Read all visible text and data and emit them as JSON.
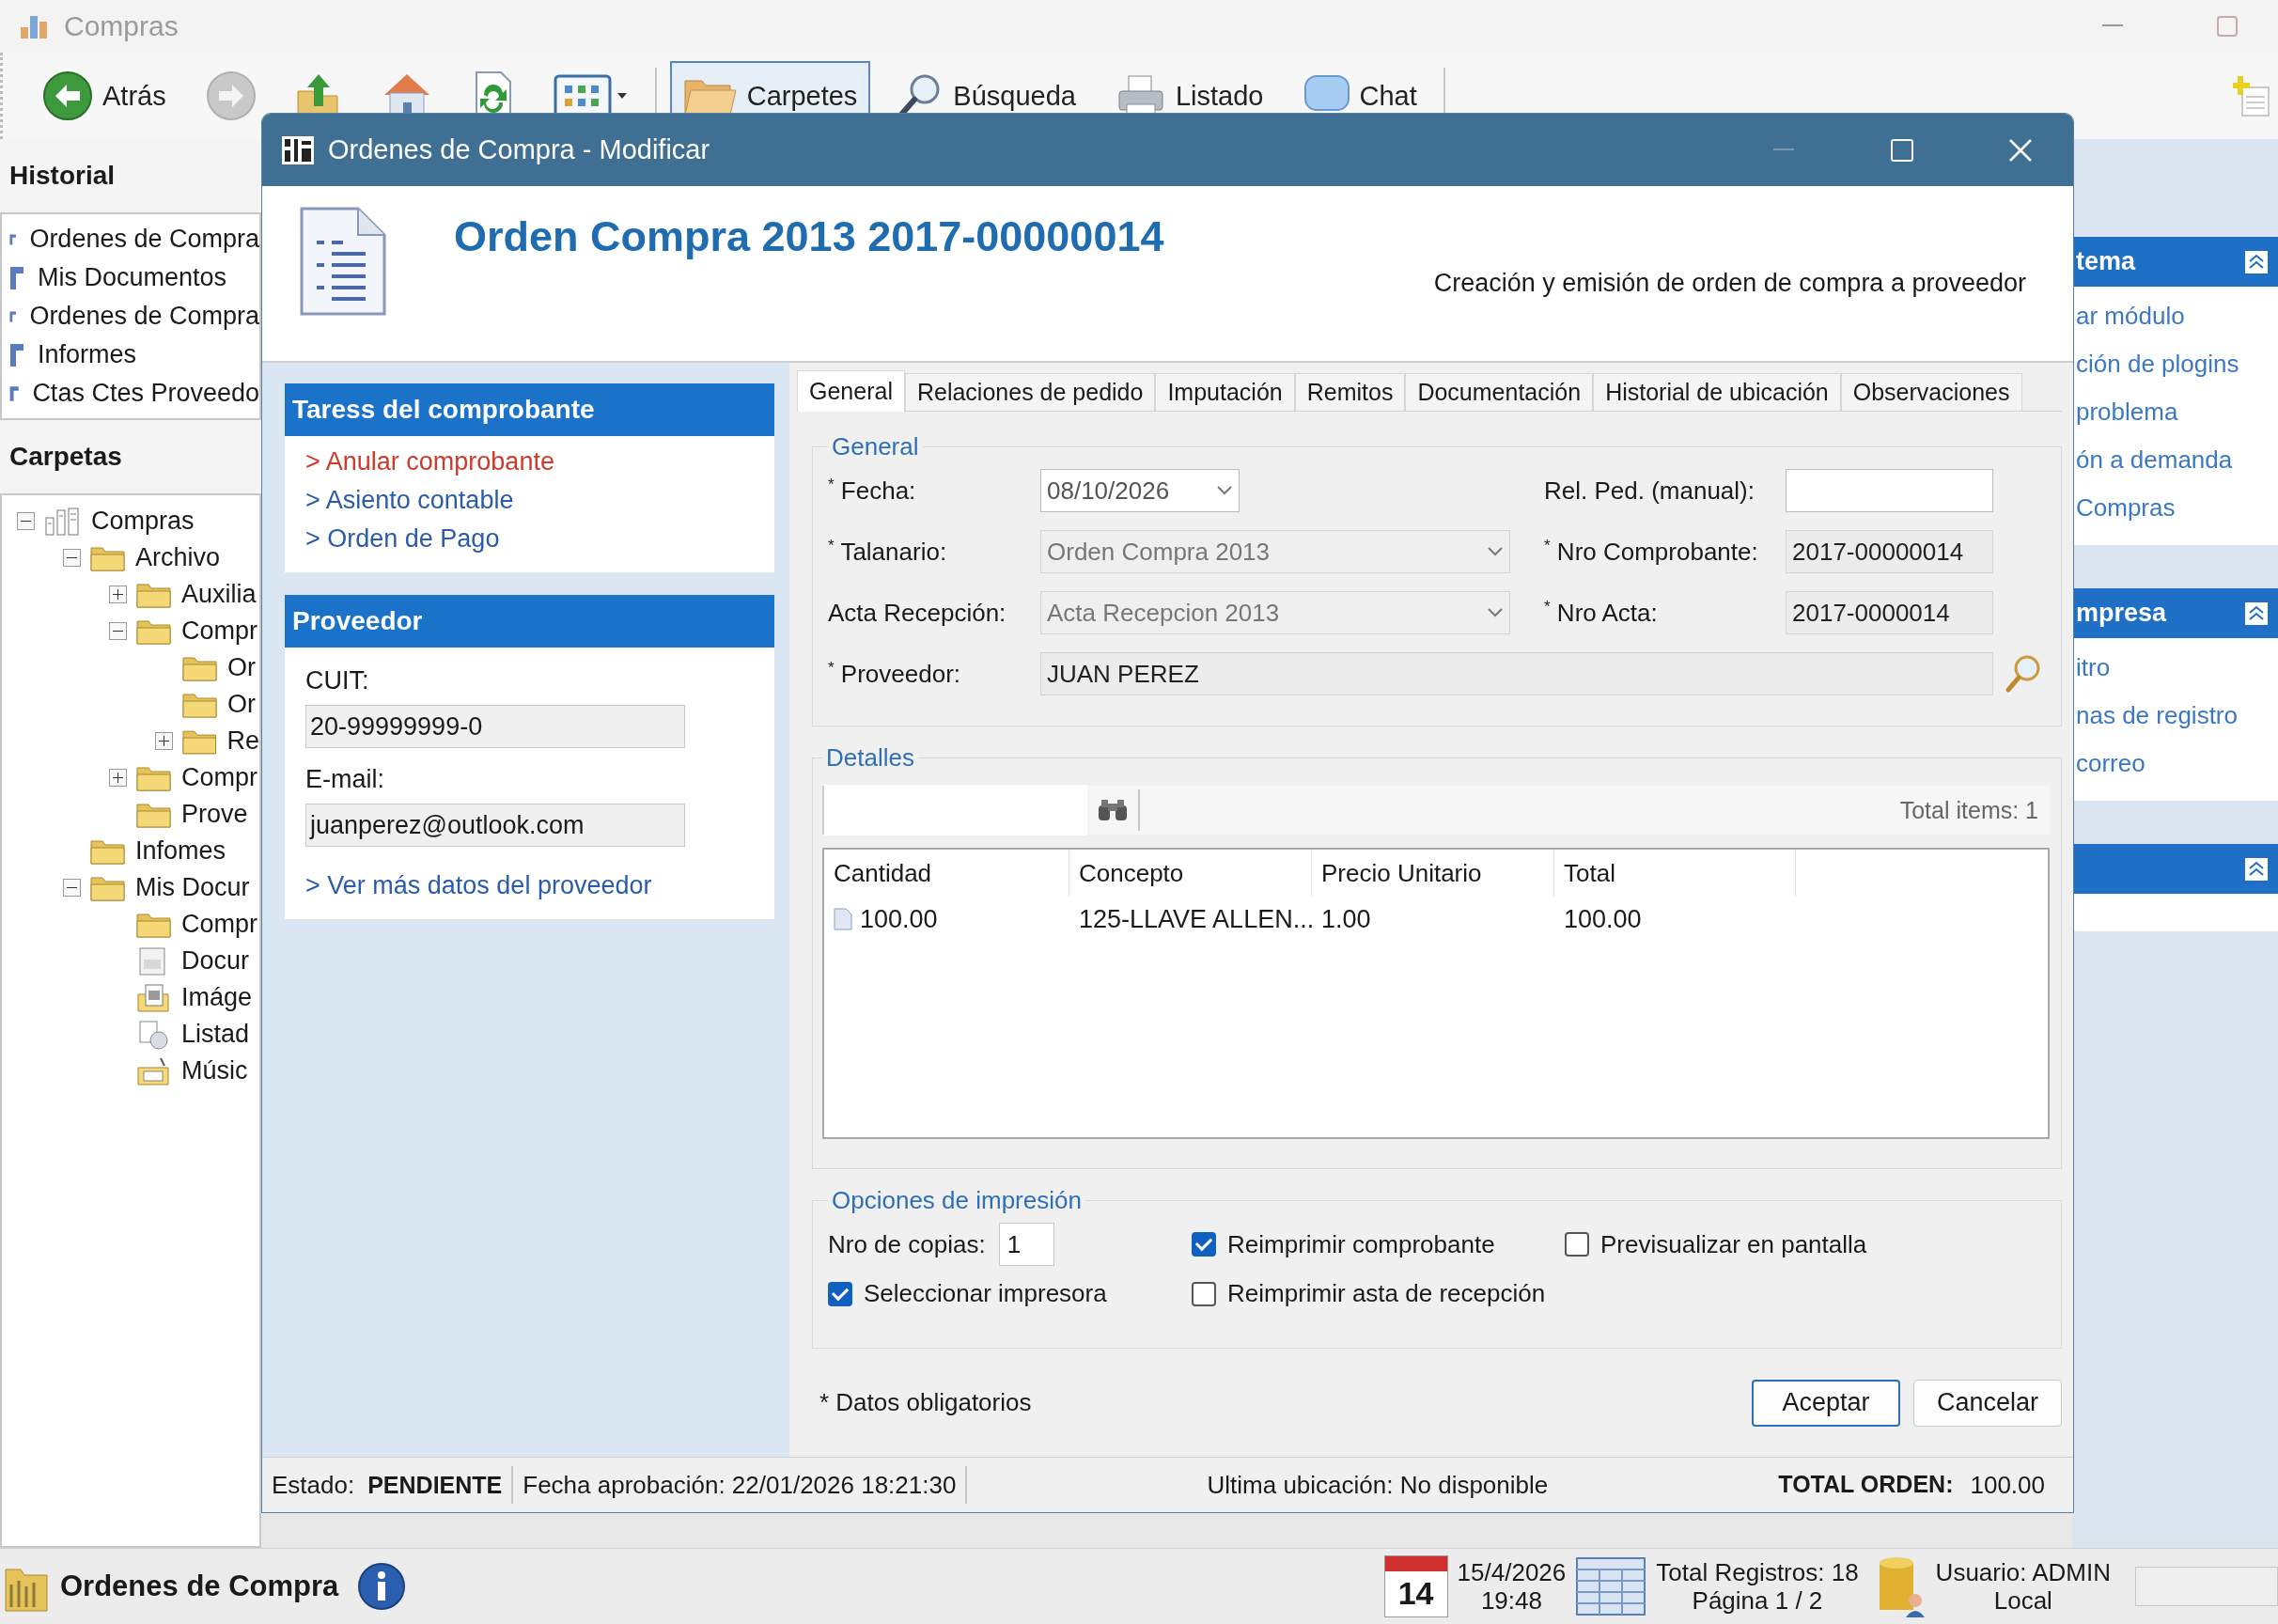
{
  "app": {
    "title": "Compras"
  },
  "toolbar": {
    "items": [
      {
        "kind": "back",
        "label": "Atrás",
        "selected": false
      },
      {
        "kind": "forward",
        "selected": false
      },
      {
        "kind": "up",
        "selected": false
      },
      {
        "kind": "home",
        "selected": false
      },
      {
        "kind": "refresh",
        "selected": false
      },
      {
        "kind": "views",
        "selected": false
      },
      {
        "kind": "folders",
        "label": "Carpetes",
        "selected": true
      },
      {
        "kind": "search",
        "label": "Búsqueda",
        "selected": false
      },
      {
        "kind": "print",
        "label": "Listado",
        "selected": false
      },
      {
        "kind": "chat",
        "label": "Chat",
        "selected": false
      }
    ]
  },
  "history": {
    "title": "Historial",
    "items": [
      "Ordenes de Compra",
      "Mis Documentos",
      "Ordenes de Compra",
      "Informes",
      "Ctas Ctes Proveedo"
    ]
  },
  "folders": {
    "title": "Carpetas",
    "tree": [
      {
        "label": "Compras",
        "kind": "app",
        "expanded": true,
        "children": [
          {
            "label": "Archivo",
            "kind": "folder",
            "expanded": true,
            "children": [
              {
                "label": "Auxilia",
                "kind": "folder",
                "expanded": false
              },
              {
                "label": "Compr",
                "kind": "folder",
                "expanded": true,
                "children": [
                  {
                    "label": "Or",
                    "kind": "folder"
                  },
                  {
                    "label": "Or",
                    "kind": "folder"
                  },
                  {
                    "label": "Re",
                    "kind": "folder",
                    "expanded": false
                  }
                ]
              },
              {
                "label": "Compr",
                "kind": "folder",
                "expanded": false
              },
              {
                "label": "Prove",
                "kind": "folder"
              }
            ]
          },
          {
            "label": "Infomes",
            "kind": "folder"
          },
          {
            "label": "Mis Docur",
            "kind": "folder",
            "expanded": true,
            "children": [
              {
                "label": "Compr",
                "kind": "folder"
              },
              {
                "label": "Docur",
                "kind": "document"
              },
              {
                "label": "Imáge",
                "kind": "image"
              },
              {
                "label": "Listad",
                "kind": "list"
              },
              {
                "label": "Músic",
                "kind": "music"
              }
            ]
          }
        ]
      }
    ]
  },
  "side_panel": {
    "sections": [
      {
        "kind": "links",
        "title": "tema",
        "links": [
          "ar módulo",
          "ción de plogins",
          "problema",
          "ón a demanda",
          "Compras"
        ]
      },
      {
        "kind": "links",
        "title": "mpresa",
        "links": [
          "itro",
          "nas de registro",
          "correo"
        ]
      },
      {
        "kind": "blank"
      }
    ]
  },
  "dialog": {
    "title": "Ordenes de Compra - Modificar",
    "heading": "Orden Compra 2013 2017-00000014",
    "subheading": "Creación y emisión de orden de compra a proveedor",
    "tasks": {
      "title": "Taress del comprobante",
      "links": [
        {
          "label": "> Anular comprobante",
          "kind": "danger"
        },
        {
          "label": "> Asiento contable",
          "kind": "normal"
        },
        {
          "label": "> Orden de Pago",
          "kind": "normal"
        }
      ]
    },
    "supplier": {
      "title": "Proveedor",
      "fields": [
        {
          "label": "CUIT:",
          "value": "20-99999999-0"
        },
        {
          "label": "E-mail:",
          "value": "juanperez@outlook.com"
        }
      ],
      "link": "> Ver más datos del proveedor"
    },
    "tabs": [
      {
        "label": "General",
        "selected": true
      },
      {
        "label": "Relaciones de pedido",
        "selected": false
      },
      {
        "label": "Imputación",
        "selected": false
      },
      {
        "label": "Remitos",
        "selected": false
      },
      {
        "label": "Documentación",
        "selected": false
      },
      {
        "label": "Historial de ubicación",
        "selected": false
      },
      {
        "label": "Observaciones",
        "selected": false
      }
    ],
    "general": {
      "title": "General",
      "fields": [
        {
          "label": "$^{*}$ Fecha:",
          "kind": "date",
          "value": "08/10/2026",
          "disabled": false
        },
        {
          "label": "Rel. Ped. (manual):",
          "kind": "text",
          "disabled": false
        },
        {
          "label": "$^{*}$ Talanario:",
          "kind": "combo",
          "value": "Orden Compra 2013",
          "disabled": true
        },
        {
          "label": "$^{*}$ Nro Comprobante:",
          "kind": "text",
          "value": "2017-00000014",
          "disabled": true
        },
        {
          "label": "Acta Recepción:",
          "kind": "combo",
          "value": "Acta Recepcion 2013",
          "disabled": true
        },
        {
          "label": "$^{*}$ Nro Acta:",
          "kind": "text",
          "value": "2017-0000014",
          "disabled": true
        },
        {
          "label": "$^{*}$ Proveedor:",
          "kind": "lookup",
          "value": "JUAN PEREZ",
          "disabled": true
        }
      ]
    },
    "details": {
      "title": "Detalles",
      "count": "Total items: 1",
      "table": {
        "columns": [
          "Cantidad",
          "Concepto",
          "Precio Unitario",
          "Total"
        ],
        "rows": [
          {
            "cells": [
              "100.00",
              "125-LLAVE ALLEN...",
              "1.00",
              "100.00"
            ]
          }
        ]
      }
    },
    "print_options": {
      "title": "Opciones de impresión",
      "copies_label": "Nro de copias:",
      "copies": "1",
      "checks": [
        {
          "label": "Reimprimir comprobante",
          "checked": true
        },
        {
          "label": "Previsualizar en pantalla",
          "checked": false
        },
        {
          "label": "Seleccionar impresora",
          "checked": true
        },
        {
          "label": "Reimprimir asta de recepción",
          "checked": false
        }
      ]
    },
    "required_note": "* Datos obligatorios",
    "buttons": [
      {
        "label": "Aceptar",
        "default": true
      },
      {
        "label": "Cancelar",
        "default": false
      }
    ],
    "status_bar": {
      "state_label": "Estado:",
      "state": "PENDIENTE",
      "approval": "Fecha aprobación: 22/01/2026 18:21:30",
      "location": "Ultima ubicación: No disponible",
      "total_label": "TOTAL ORDEN:",
      "total": "100.00"
    }
  },
  "taskbar": {
    "module": "Ordenes de Compra",
    "calendar_day": "14",
    "date": "15/4/2026",
    "time": "19:48",
    "records": "Total Registros: 18",
    "page": "Página 1 / 2",
    "user": "Usuario: ADMIN",
    "location": "Local"
  }
}
